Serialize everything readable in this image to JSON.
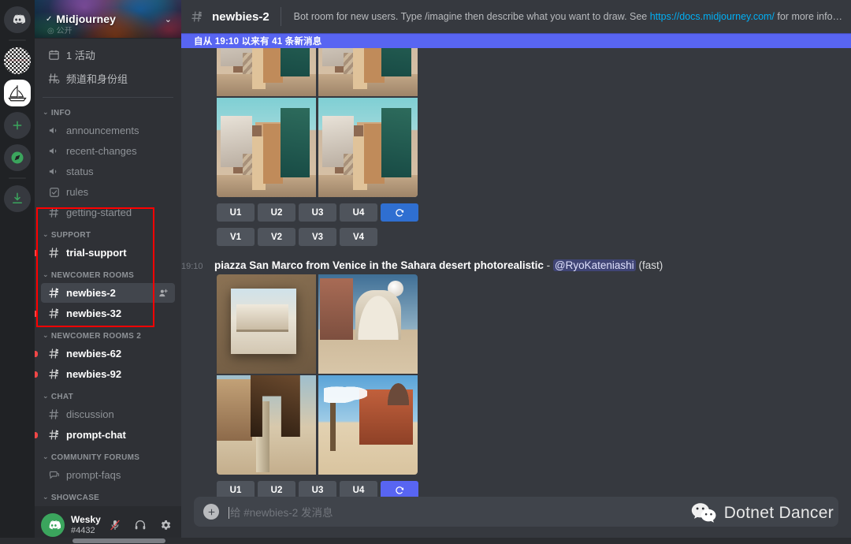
{
  "rail": {
    "items": [
      {
        "name": "discord-home",
        "label": "Discord"
      },
      {
        "name": "server-qr",
        "label": "Server"
      },
      {
        "name": "server-midjourney",
        "label": "Midjourney"
      },
      {
        "name": "add-server",
        "label": "+"
      },
      {
        "name": "explore-servers",
        "label": "Explore"
      },
      {
        "name": "download-apps",
        "label": "Download"
      }
    ]
  },
  "guild": {
    "name": "Midjourney",
    "verified_icon": "check-icon",
    "chevron": "chevron-down-icon"
  },
  "sidebar": {
    "special": [
      {
        "label": "1 活动",
        "icon": "calendar-icon"
      },
      {
        "label": "频道和身份组",
        "icon": "channels-roles-icon"
      }
    ],
    "categories": [
      {
        "label": "INFO",
        "channels": [
          {
            "label": "announcements",
            "icon": "announcement-icon",
            "state": "normal"
          },
          {
            "label": "recent-changes",
            "icon": "announcement-icon",
            "state": "normal"
          },
          {
            "label": "status",
            "icon": "announcement-icon",
            "state": "normal"
          },
          {
            "label": "rules",
            "icon": "rules-icon",
            "state": "normal"
          },
          {
            "label": "getting-started",
            "icon": "hash-icon",
            "state": "normal"
          }
        ]
      },
      {
        "label": "SUPPORT",
        "channels": [
          {
            "label": "trial-support",
            "icon": "hash-icon",
            "state": "unread"
          }
        ]
      },
      {
        "label": "NEWCOMER ROOMS",
        "channels": [
          {
            "label": "newbies-2",
            "icon": "hash-threads-icon",
            "state": "selected",
            "action_icon": "add-member-icon"
          },
          {
            "label": "newbies-32",
            "icon": "hash-threads-icon",
            "state": "unread"
          }
        ]
      },
      {
        "label": "NEWCOMER ROOMS 2",
        "channels": [
          {
            "label": "newbies-62",
            "icon": "hash-threads-icon",
            "state": "unread"
          },
          {
            "label": "newbies-92",
            "icon": "hash-threads-icon",
            "state": "unread"
          }
        ]
      },
      {
        "label": "CHAT",
        "channels": [
          {
            "label": "discussion",
            "icon": "hash-icon",
            "state": "normal"
          },
          {
            "label": "prompt-chat",
            "icon": "hash-threads-icon",
            "state": "unread"
          }
        ]
      },
      {
        "label": "COMMUNITY FORUMS",
        "channels": [
          {
            "label": "prompt-faqs",
            "icon": "forum-icon",
            "state": "normal"
          }
        ]
      },
      {
        "label": "SHOWCASE",
        "channels": []
      }
    ],
    "highlight_color": "#ff0000"
  },
  "user": {
    "name": "Wesky",
    "tag": "#4432",
    "avatar_icon": "discord-logo-icon",
    "avatar_color": "#3ba55d",
    "controls": [
      {
        "name": "mute-microphone-button",
        "icon": "microphone-muted-icon",
        "muted": true
      },
      {
        "name": "deafen-button",
        "icon": "headphones-icon",
        "muted": false
      },
      {
        "name": "user-settings-button",
        "icon": "gear-icon",
        "muted": false
      }
    ]
  },
  "topbar": {
    "channel_icon": "hash-threads-icon",
    "channel_name": "newbies-2",
    "topic_before": "Bot room for new users. Type /imagine then describe what you want to draw. See ",
    "topic_link": "https://docs.midjourney.com/",
    "topic_after": " for more information"
  },
  "new_messages_bar": {
    "text": "自从 19:10 以来有 41 条新消息",
    "color": "#5865f2"
  },
  "messages": [
    {
      "id": "msg-desert-city",
      "images": [
        {
          "alt": "desert city top-left",
          "style": "art-desert"
        },
        {
          "alt": "desert city top-right",
          "style": "art-desert"
        },
        {
          "alt": "desert city bottom-left",
          "style": "art-desert"
        },
        {
          "alt": "desert city bottom-right",
          "style": "art-desert"
        }
      ],
      "buttons_rows": [
        [
          {
            "label": "U1",
            "style": "default"
          },
          {
            "label": "U2",
            "style": "default"
          },
          {
            "label": "U3",
            "style": "default"
          },
          {
            "label": "U4",
            "style": "default"
          },
          {
            "label": "",
            "style": "primary",
            "icon": "refresh-icon"
          }
        ],
        [
          {
            "label": "V1",
            "style": "default"
          },
          {
            "label": "V2",
            "style": "default"
          },
          {
            "label": "V3",
            "style": "default"
          },
          {
            "label": "V4",
            "style": "default"
          }
        ]
      ]
    },
    {
      "id": "msg-piazza-san-marco",
      "timestamp": "19:10",
      "prompt": "piazza San Marco from Venice in the Sahara desert photorealistic",
      "separator": "-",
      "mention": "@RyoKateniashi",
      "suffix": "(fast)",
      "images": [
        {
          "alt": "piazza san marco painting on easel",
          "style": "art-venice1"
        },
        {
          "alt": "st marks basilica with moon",
          "style": "art-venice2"
        },
        {
          "alt": "colonnade with campanile",
          "style": "art-venice3"
        },
        {
          "alt": "red palace on beach",
          "style": "art-venice4"
        }
      ],
      "buttons_rows": [
        [
          {
            "label": "U1",
            "style": "default"
          },
          {
            "label": "U2",
            "style": "default"
          },
          {
            "label": "U3",
            "style": "default"
          },
          {
            "label": "U4",
            "style": "default"
          },
          {
            "label": "",
            "style": "blurple",
            "icon": "refresh-icon"
          }
        ]
      ]
    }
  ],
  "composer": {
    "placeholder": "给 #newbies-2 发消息",
    "add_icon": "plus-icon"
  },
  "watermark": {
    "text": "Dotnet Dancer",
    "icon": "wechat-bubbles-icon"
  }
}
